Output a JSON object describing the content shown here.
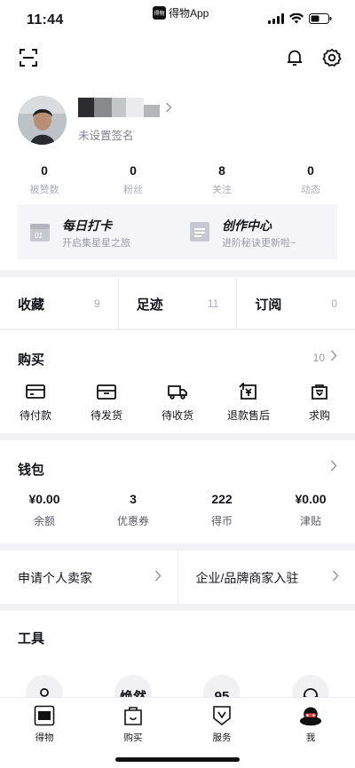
{
  "status_bar": {
    "time": "11:44",
    "app_name": "得物App",
    "app_logo_text": "得物"
  },
  "top_bar": {
    "scan_icon": "scan-icon",
    "bell_icon": "bell-icon",
    "settings_icon": "gear-icon"
  },
  "profile": {
    "signature": "未设置签名"
  },
  "stats": [
    {
      "value": "0",
      "label": "被赞数"
    },
    {
      "value": "0",
      "label": "粉丝"
    },
    {
      "value": "8",
      "label": "关注"
    },
    {
      "value": "0",
      "label": "动态"
    }
  ],
  "cards": [
    {
      "title": "每日打卡",
      "subtitle": "开启集星星之旅",
      "icon_text": "01"
    },
    {
      "title": "创作中心",
      "subtitle": "进阶秘诀更新啦~"
    }
  ],
  "collections": [
    {
      "label": "收藏",
      "count": "9"
    },
    {
      "label": "足迹",
      "count": "11"
    },
    {
      "label": "订阅",
      "count": "0"
    }
  ],
  "purchase": {
    "title": "购买",
    "count": "10",
    "items": [
      {
        "label": "待付款",
        "icon": "card-icon"
      },
      {
        "label": "待发货",
        "icon": "box-icon"
      },
      {
        "label": "待收货",
        "icon": "truck-icon"
      },
      {
        "label": "退款售后",
        "icon": "refund-icon"
      },
      {
        "label": "求购",
        "icon": "bag-icon"
      }
    ]
  },
  "wallet": {
    "title": "钱包",
    "items": [
      {
        "value": "¥0.00",
        "label": "余额"
      },
      {
        "value": "3",
        "label": "优惠券"
      },
      {
        "value": "222",
        "label": "得币"
      },
      {
        "value": "¥0.00",
        "label": "津贴"
      }
    ]
  },
  "seller": [
    {
      "label": "申请个人卖家"
    },
    {
      "label": "企业/品牌商家入驻"
    }
  ],
  "tools": {
    "title": "工具",
    "items": [
      {
        "text": ""
      },
      {
        "text": "焕然"
      },
      {
        "text": "95"
      },
      {
        "text": ""
      }
    ]
  },
  "tab_bar": {
    "items": [
      {
        "label": "得物",
        "icon": "dewu-logo-icon"
      },
      {
        "label": "购买",
        "icon": "shopping-bag-icon"
      },
      {
        "label": "服务",
        "icon": "shield-v-icon"
      },
      {
        "label": "我",
        "icon": "profile-avatar-icon"
      }
    ]
  },
  "colors": {
    "text": "#14151a",
    "muted": "#aaaabb",
    "divider": "#f2f2f5",
    "card_bg": "#f5f5f9"
  }
}
